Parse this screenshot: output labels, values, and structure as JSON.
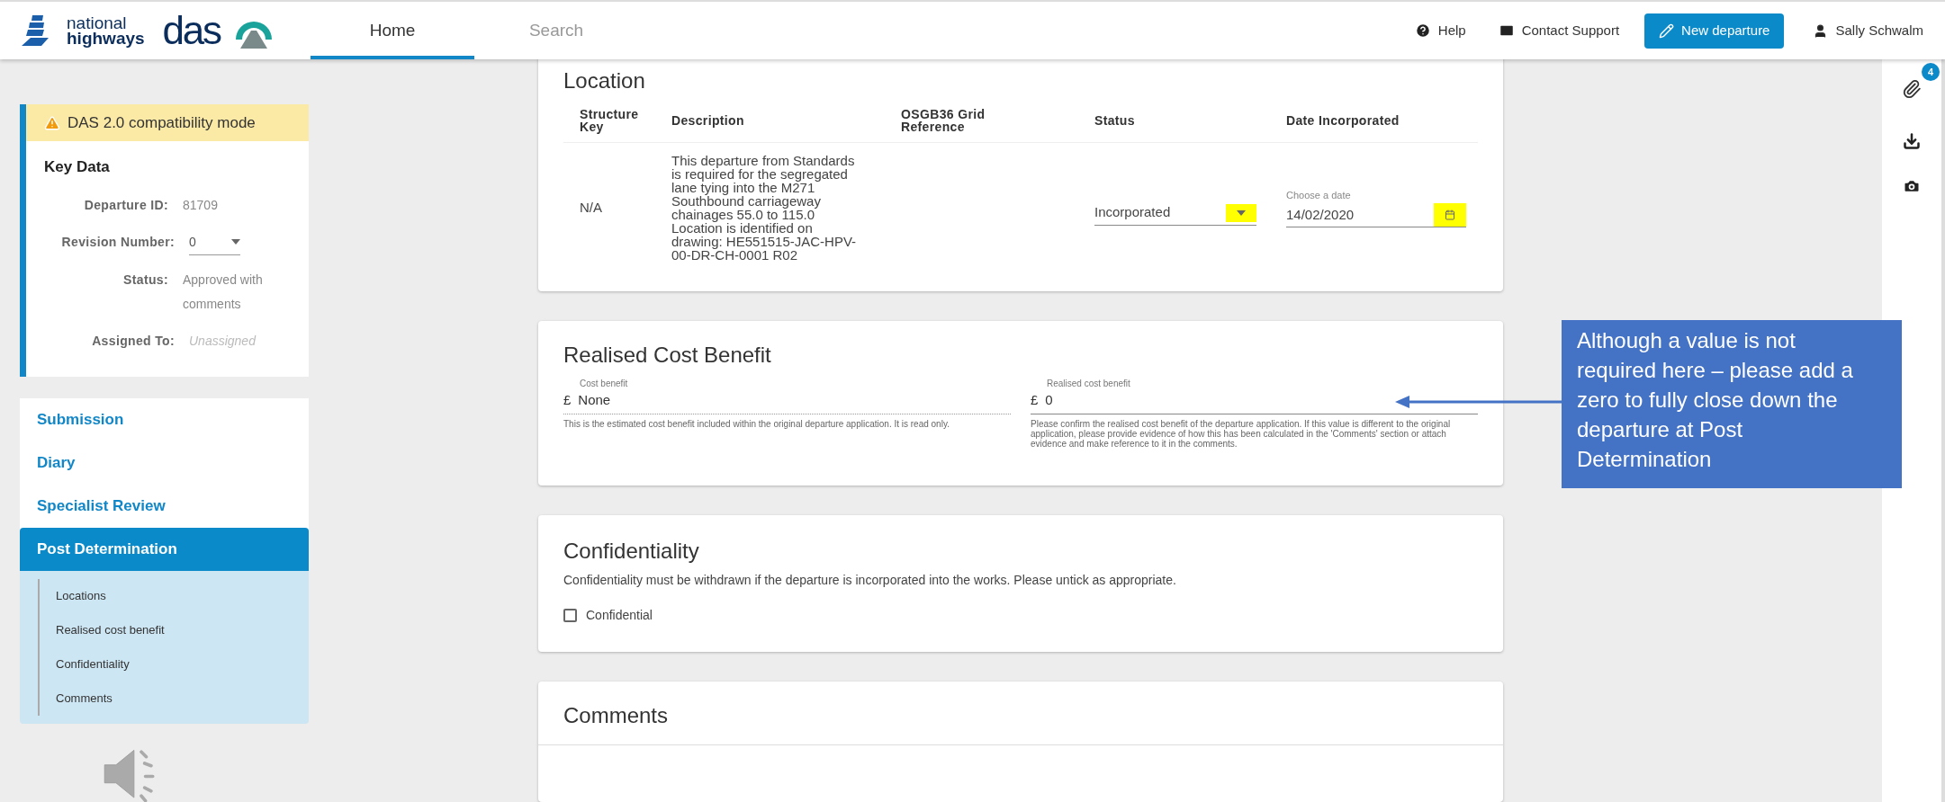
{
  "header": {
    "brand": [
      "national",
      "highways"
    ],
    "app_name": "das",
    "tabs": [
      {
        "label": "Home",
        "selected": true
      },
      {
        "label": "Search",
        "selected": false
      }
    ],
    "help": "Help",
    "contact": "Contact Support",
    "new_departure": "New departure",
    "user": "Sally Schwalm"
  },
  "sidebar": {
    "banner": "DAS 2.0 compatibility mode",
    "key_data": {
      "title": "Key Data",
      "fields": [
        {
          "label": "Departure ID:",
          "value": "81709",
          "kind": "text"
        },
        {
          "label": "Revision Number:",
          "value": "0",
          "kind": "select"
        },
        {
          "label": "Status:",
          "value": "Approved with comments",
          "kind": "text"
        },
        {
          "label": "Assigned To:",
          "value": "Unassigned",
          "kind": "muted"
        }
      ]
    },
    "nav": [
      {
        "label": "Submission",
        "selected": false
      },
      {
        "label": "Diary",
        "selected": false
      },
      {
        "label": "Specialist Review",
        "selected": false
      },
      {
        "label": "Post Determination",
        "selected": true
      }
    ],
    "subnav": [
      "Locations",
      "Realised cost benefit",
      "Confidentiality",
      "Comments"
    ]
  },
  "location": {
    "title": "Location",
    "columns": [
      "Structure Key",
      "Description",
      "OSGB36 Grid Reference",
      "Status",
      "Date Incorporated"
    ],
    "rows": [
      {
        "structure_key": "N/A",
        "description": "This departure from Standards is required for the segregated lane tying into the M271 Southbound carriageway chainages 55.0 to 115.0 Location is identified on drawing: HE551515-JAC-HPV-00-DR-CH-0001 R02",
        "status": {
          "value": "Incorporated",
          "highlighted": true
        },
        "date": {
          "label": "Choose a date",
          "value": "14/02/2020",
          "highlighted": true
        }
      }
    ]
  },
  "cost_benefit": {
    "title": "Realised Cost Benefit",
    "fields": [
      {
        "label": "Cost benefit",
        "currency": "£",
        "value": "None",
        "hint": "This is the estimated cost benefit included within the original departure application. It is read only.",
        "kind": "readonly"
      },
      {
        "label": "Realised cost benefit",
        "currency": "£",
        "value": "0",
        "hint": "Please confirm the realised cost benefit of the departure application. If this value is different to the original application, please provide evidence of how this has been calculated in the 'Comments' section or attach evidence and make reference to it in the comments.",
        "kind": "input"
      }
    ]
  },
  "confidentiality": {
    "title": "Confidentiality",
    "text": "Confidentiality must be withdrawn if the departure is incorporated into the works. Please untick as appropriate.",
    "checkbox": {
      "label": "Confidential",
      "checked": false
    }
  },
  "comments": {
    "title": "Comments"
  },
  "right_rail": {
    "attachments_count": "4"
  },
  "callout": {
    "text": "Although a value is not required here – please add a zero to fully close down the departure at Post Determination"
  }
}
